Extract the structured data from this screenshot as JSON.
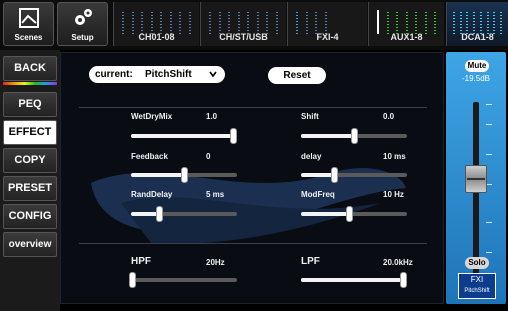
{
  "topbar": {
    "scenes_label": "Scenes",
    "setup_label": "Setup",
    "groups": [
      {
        "label": "CH01-08"
      },
      {
        "label": "CH/ST/USB"
      },
      {
        "label": "FXI-4"
      },
      {
        "label": "AUX1-8"
      },
      {
        "label": "DCA1-8"
      }
    ],
    "icons": {
      "scenes": "window-icon",
      "setup": "gears-icon"
    }
  },
  "sidebar": {
    "items": [
      {
        "label": "BACK"
      },
      {
        "label": "PEQ"
      },
      {
        "label": "EFFECT",
        "selected": true
      },
      {
        "label": "COPY"
      },
      {
        "label": "PRESET"
      },
      {
        "label": "CONFIG"
      },
      {
        "label": "overview"
      }
    ]
  },
  "main": {
    "current_label": "current:",
    "current_value": "PitchShift",
    "dropdown_icon": "chevron-down-icon",
    "reset_label": "Reset",
    "params": [
      {
        "name": "WetDryMix",
        "value": "1.0",
        "level": 1.0
      },
      {
        "name": "Shift",
        "value": "0.0",
        "level": 0.5
      },
      {
        "name": "Feedback",
        "value": "0",
        "level": 0.5
      },
      {
        "name": "delay",
        "value": "10 ms",
        "level": 0.3
      },
      {
        "name": "RandDelay",
        "value": "5 ms",
        "level": 0.25
      },
      {
        "name": "ModFreq",
        "value": "10 Hz",
        "level": 0.45
      }
    ],
    "filters": [
      {
        "name": "HPF",
        "value": "20Hz",
        "level": 0.0
      },
      {
        "name": "LPF",
        "value": "20.0kHz",
        "level": 1.0
      }
    ]
  },
  "strip": {
    "mute_label": "Mute",
    "level_db": "-19.5dB",
    "solo_label": "Solo",
    "channel_label": "FXI",
    "effect_name": "PitchShift"
  },
  "colors": {
    "accent_blue": "#2f8fd6",
    "selected_bg": "#ffffff"
  }
}
